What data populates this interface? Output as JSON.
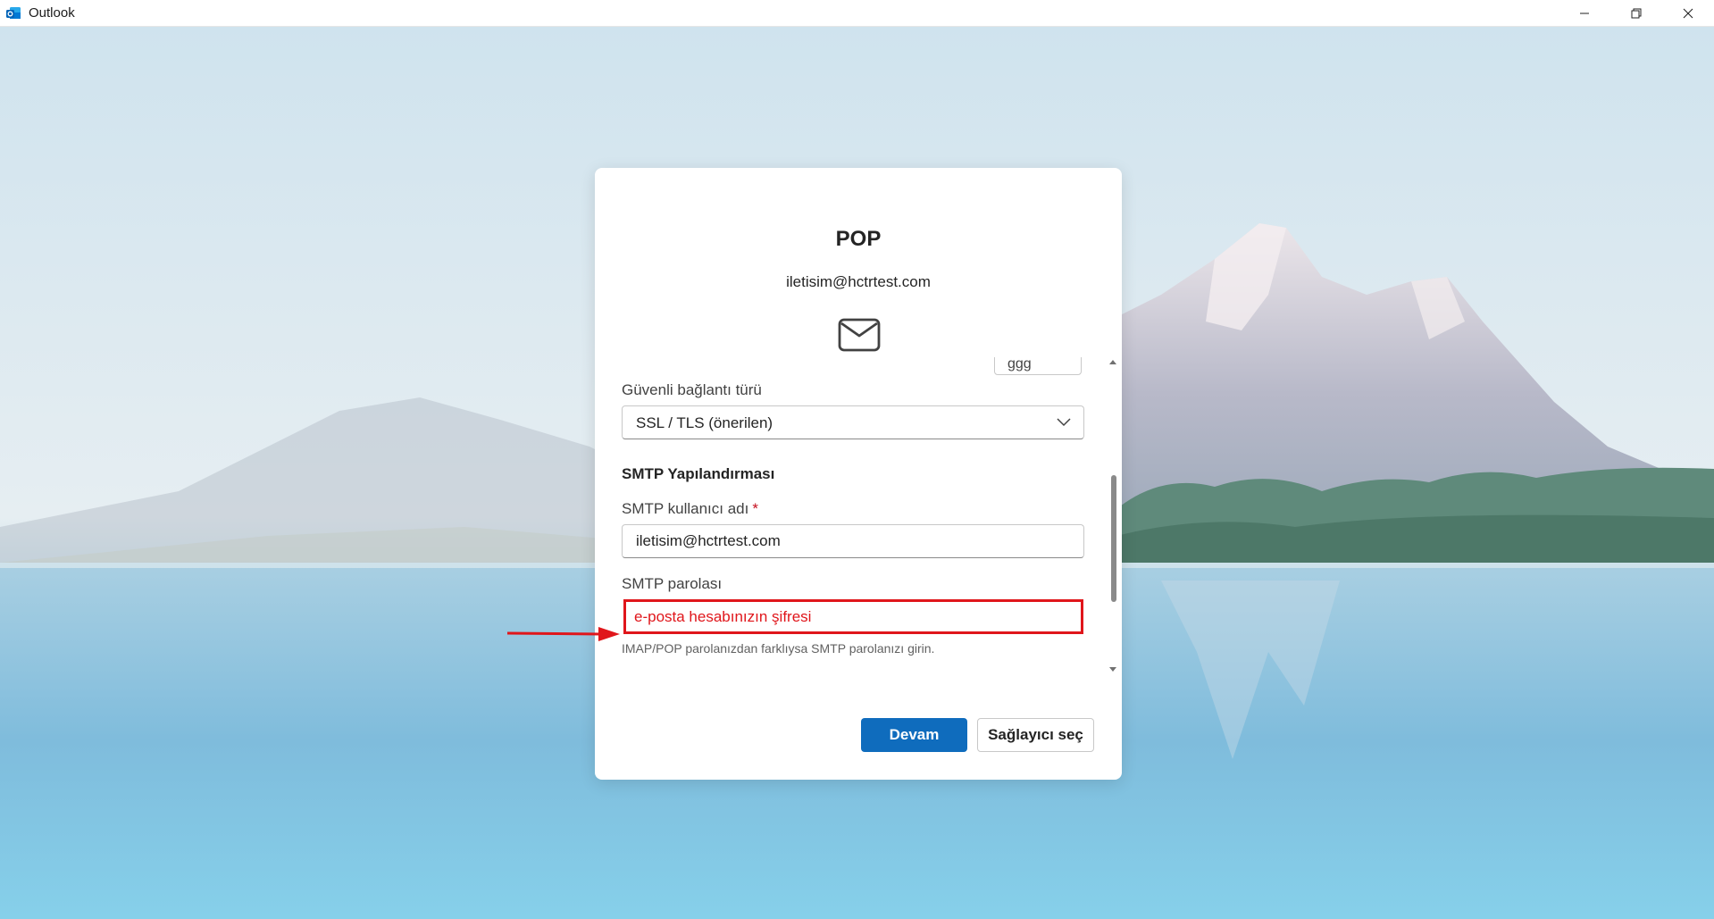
{
  "window": {
    "title": "Outlook",
    "minimize_icon": "minimize-icon",
    "restore_icon": "restore-icon",
    "close_icon": "close-icon"
  },
  "dialog": {
    "title": "POP",
    "email": "iletisim@hctrtest.com",
    "mail_icon": "mail-envelope-icon",
    "partial_value": "ggg",
    "secure_connection_label": "Güvenli bağlantı türü",
    "secure_connection_value": "SSL / TLS (önerilen)",
    "smtp_section_title": "SMTP Yapılandırması",
    "smtp_username_label": "SMTP kullanıcı adı",
    "smtp_username_required": "*",
    "smtp_username_value": "iletisim@hctrtest.com",
    "smtp_password_label": "SMTP parolası",
    "smtp_password_value": "e-posta hesabınızın şifresi",
    "smtp_password_hint": "IMAP/POP parolanızdan farklıysa SMTP parolanızı girin.",
    "continue_button": "Devam",
    "choose_provider_button": "Sağlayıcı seç"
  },
  "colors": {
    "primary": "#0f6cbd",
    "annotation_red": "#e0161b"
  }
}
